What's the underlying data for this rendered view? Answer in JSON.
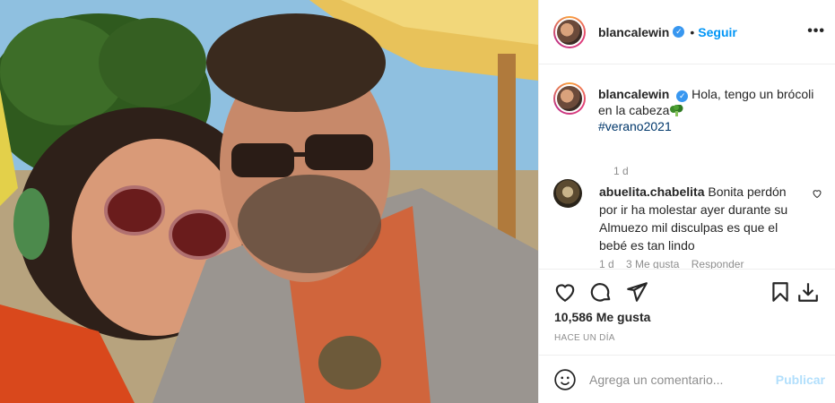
{
  "post": {
    "username": "blancalewin",
    "follow_label": "Seguir",
    "separator": "•",
    "more_label": "•••"
  },
  "caption": {
    "username": "blancalewin",
    "text": "Hola, tengo un brócoli en la cabeza",
    "hashtag": "#verano2021",
    "time": "1 d"
  },
  "comment": {
    "username": "abuelita.chabelita",
    "text": "Bonita perdón por ir ha molestar ayer durante su Almuezo mil disculpas es que el bebé es tan lindo",
    "time": "1 d",
    "likes": "3 Me gusta",
    "reply_label": "Responder"
  },
  "stats": {
    "likes": "10,586 Me gusta",
    "posted": "HACE UN DÍA"
  },
  "add_comment": {
    "placeholder": "Agrega un comentario...",
    "publish_label": "Publicar"
  },
  "colors": {
    "accent": "#0095f6",
    "hashtag": "#00376b",
    "muted": "#8e8e8e",
    "verified": "#3897f0"
  }
}
